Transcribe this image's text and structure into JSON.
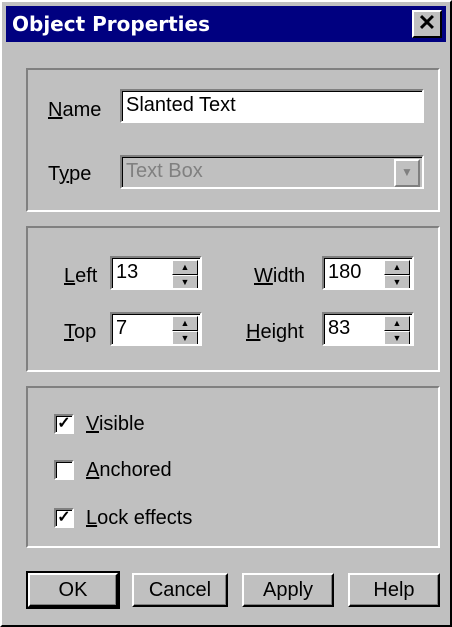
{
  "window": {
    "title": "Object Properties",
    "close_glyph": "✕"
  },
  "general": {
    "name_label_mn": "N",
    "name_label_rest": "ame",
    "name_value": "Slanted Text",
    "type_label_pre": "T",
    "type_label_mn": "y",
    "type_label_rest": "pe",
    "type_value": "Text Box",
    "type_disabled": true
  },
  "geometry": {
    "left_label_mn": "L",
    "left_label_rest": "eft",
    "left_value": "13",
    "top_label_mn": "T",
    "top_label_rest": "op",
    "top_value": "7",
    "width_label_mn": "W",
    "width_label_rest": "idth",
    "width_value": "180",
    "height_label_mn": "H",
    "height_label_rest": "eight",
    "height_value": "83"
  },
  "options": {
    "visible": {
      "label_mn": "V",
      "label_rest": "isible",
      "checked": true
    },
    "anchored": {
      "label_mn": "A",
      "label_rest": "nchored",
      "checked": false
    },
    "lock_effects": {
      "label_mn": "L",
      "label_rest": "ock effects",
      "checked": true
    },
    "check_glyph": "✓"
  },
  "buttons": {
    "ok": "OK",
    "cancel": "Cancel",
    "apply": "Apply",
    "help": "Help"
  },
  "icons": {
    "combo_arrow": "chevron-down-icon",
    "spin_up": "arrow-up-icon",
    "spin_down": "arrow-down-icon",
    "close": "close-icon"
  },
  "colors": {
    "titlebar": "#000080",
    "face": "#c0c0c0",
    "disabled_text": "#808080"
  }
}
